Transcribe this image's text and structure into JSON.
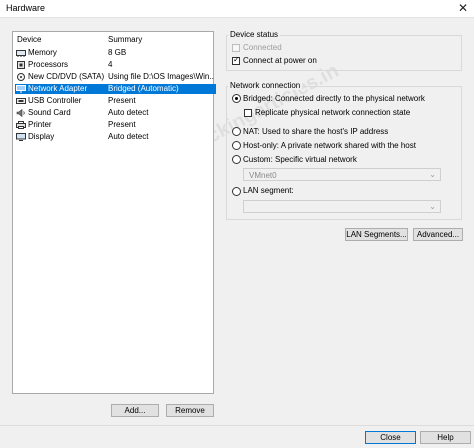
{
  "window": {
    "title": "Hardware"
  },
  "device_list": {
    "headers": {
      "device": "Device",
      "summary": "Summary"
    },
    "items": [
      {
        "name": "Memory",
        "summary": "8 GB",
        "icon": "memory-icon"
      },
      {
        "name": "Processors",
        "summary": "4",
        "icon": "processor-icon"
      },
      {
        "name": "New CD/DVD (SATA)",
        "summary": "Using file D:\\OS Images\\Win...",
        "icon": "cd-dvd-icon"
      },
      {
        "name": "Network Adapter",
        "summary": "Bridged (Automatic)",
        "icon": "network-adapter-icon",
        "selected": true
      },
      {
        "name": "USB Controller",
        "summary": "Present",
        "icon": "usb-icon"
      },
      {
        "name": "Sound Card",
        "summary": "Auto detect",
        "icon": "sound-card-icon"
      },
      {
        "name": "Printer",
        "summary": "Present",
        "icon": "printer-icon"
      },
      {
        "name": "Display",
        "summary": "Auto detect",
        "icon": "display-icon"
      }
    ],
    "add_label": "Add...",
    "remove_label": "Remove"
  },
  "device_status": {
    "title": "Device status",
    "connected": {
      "label": "Connected",
      "checked": false,
      "disabled": true
    },
    "connect_at_power_on": {
      "label": "Connect at power on",
      "checked": true
    }
  },
  "network_connection": {
    "title": "Network connection",
    "bridged": {
      "label": "Bridged: Connected directly to the physical network",
      "selected": true
    },
    "replicate": {
      "label": "Replicate physical network connection state",
      "checked": false
    },
    "nat": {
      "label": "NAT: Used to share the host's IP address"
    },
    "host_only": {
      "label": "Host-only: A private network shared with the host"
    },
    "custom": {
      "label": "Custom: Specific virtual network"
    },
    "vmnet_select": {
      "value": "VMnet0"
    },
    "lan_segment": {
      "label": "LAN segment:"
    },
    "lan_select": {
      "value": ""
    }
  },
  "buttons": {
    "lan_segments": "LAN Segments...",
    "advanced": "Advanced...",
    "close": "Close",
    "help": "Help"
  },
  "watermark": {
    "text": "www.hackingarticles.in"
  },
  "colors": {
    "selection": "#0078d7",
    "window_bg": "#f0f0f0"
  }
}
